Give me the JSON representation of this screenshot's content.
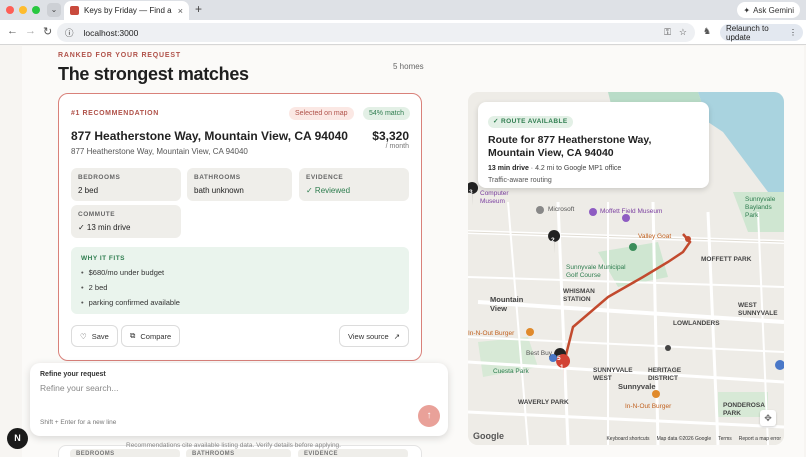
{
  "browser": {
    "tab_title": "Keys by Friday — Find a home",
    "new_tab": "+",
    "ask_gemini": "Ask Gemini",
    "url": "localhost:3000",
    "relaunch": "Relaunch to update"
  },
  "header": {
    "eyebrow": "RANKED FOR YOUR REQUEST",
    "title": "The strongest matches",
    "count": "5 homes"
  },
  "card": {
    "rank_label": "#1 RECOMMENDATION",
    "badge_map": "Selected on map",
    "badge_match": "54% match",
    "address": "877 Heatherstone Way, Mountain View, CA 94040",
    "sub_address": "877 Heatherstone Way, Mountain View, CA 94040",
    "price": "$3,320",
    "per_month": "/ month",
    "stats": {
      "bedrooms_label": "BEDROOMS",
      "bedrooms_value": "2 bed",
      "bathrooms_label": "BATHROOMS",
      "bathrooms_value": "bath unknown",
      "evidence_label": "EVIDENCE",
      "evidence_value": "✓ Reviewed",
      "commute_label": "COMMUTE",
      "commute_value": "✓ 13 min drive"
    },
    "why_label": "WHY IT FITS",
    "why_items": [
      "$680/mo under budget",
      "2 bed",
      "parking confirmed available"
    ],
    "save": "Save",
    "compare": "Compare",
    "view_source": "View source"
  },
  "map": {
    "route_badge": "✓ ROUTE AVAILABLE",
    "route_title": "Route for 877 Heatherstone Way, Mountain View, CA 94040",
    "route_time": "13 min drive",
    "route_detail": " · 4.2 mi to Google MP1 office",
    "route_note": "Traffic-aware routing",
    "labels": {
      "computer": "Computer",
      "museum": "Museum",
      "microsoft": "Microsoft",
      "moffett": "Moffett Field Museum",
      "valley_goat": "Valley Goat",
      "moffett_park": "MOFFETT PARK",
      "sunnyvale_golf": "Sunnyvale Municipal Golf Course",
      "whisman": "WHISMAN STATION",
      "mountain_view": "Mountain View",
      "lowlanders": "LOWLANDERS",
      "in_n_out_1": "In-N-Out Burger",
      "best_buy": "Best Buy",
      "cuesta_park": "Cuesta Park",
      "sunnyvale_west": "SUNNYVALE WEST",
      "heritage": "HERITAGE DISTRICT",
      "sunnyvale": "Sunnyvale",
      "in_n_out_2": "In-N-Out Burger",
      "ponderosa": "PONDEROSA PARK",
      "waverly": "WAVERLY PARK",
      "sunnyvale_baylands": "Sunnyvale Baylands Park",
      "west_sunnyvale": "WEST SUNNYVALE",
      "sunnyvale_west_2": "SUNNYVALE"
    },
    "pins": [
      "3",
      "2",
      "1",
      "5"
    ],
    "google": "Google",
    "footer": [
      "Keyboard shortcuts",
      "Map data ©2026 Google",
      "Terms",
      "Report a map error"
    ]
  },
  "refine": {
    "label": "Refine your request",
    "placeholder": "Refine your search...",
    "hint": "Shift + Enter for a new line",
    "send": "↑"
  },
  "footer": {
    "disclaimer": "Recommendations cite available listing data. Verify details before applying.",
    "next_stats": [
      "BEDROOMS",
      "BATHROOMS",
      "EVIDENCE"
    ]
  },
  "n_badge": "N",
  "colors": {
    "accent": "#b0524a",
    "card_border": "#d9817a",
    "match_green": "#2e7d4f",
    "route": "#c24a2e"
  }
}
